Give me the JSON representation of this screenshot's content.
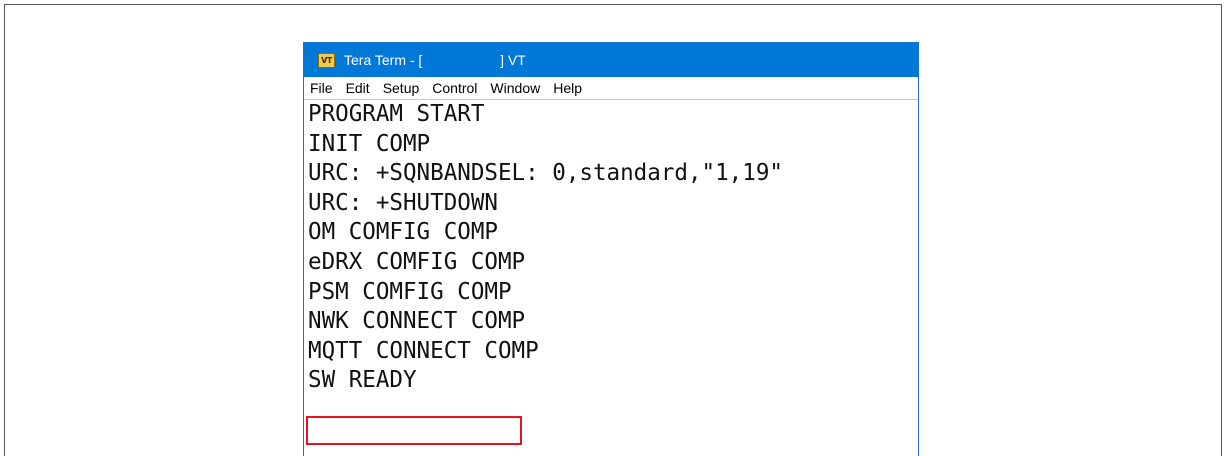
{
  "window": {
    "title": "Tera Term - [                    ] VT",
    "icon": "VT"
  },
  "menu": {
    "items": [
      "File",
      "Edit",
      "Setup",
      "Control",
      "Window",
      "Help"
    ]
  },
  "terminal": {
    "lines": [
      "PROGRAM START",
      "INIT COMP",
      "URC: +SQNBANDSEL: 0,standard,\"1,19\"",
      "URC: +SHUTDOWN",
      "OM COMFIG COMP",
      "eDRX COMFIG COMP",
      "PSM COMFIG COMP",
      "NWK CONNECT COMP",
      "MQTT CONNECT COMP",
      "SW READY"
    ]
  },
  "colors": {
    "titlebar": "#0078d7",
    "highlight": "#e8141f"
  }
}
